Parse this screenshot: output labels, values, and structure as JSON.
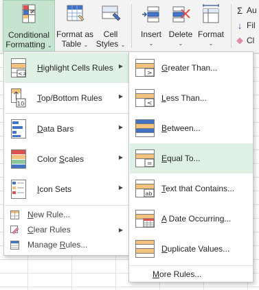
{
  "colors": {
    "accent_green": "#c5e3cf",
    "hover_green": "#dff0e4",
    "icon_orange": "#f2c27e",
    "icon_blue": "#4472c4",
    "icon_red": "#d9534f"
  },
  "ribbon": {
    "conditional_formatting": {
      "line1": "Conditional",
      "line2": "Formatting",
      "chevron": "⌄",
      "icon": "conditional-formatting-icon"
    },
    "format_as_table": {
      "line1": "Format as",
      "line2": "Table",
      "chevron": "⌄",
      "icon": "table-icon"
    },
    "cell_styles": {
      "line1": "Cell",
      "line2": "Styles",
      "chevron": "⌄",
      "icon": "cell-styles-icon"
    },
    "insert": {
      "line1": "Insert",
      "chevron": "⌄",
      "icon": "insert-icon"
    },
    "delete": {
      "line1": "Delete",
      "chevron": "⌄",
      "icon": "delete-icon"
    },
    "format": {
      "line1": "Format",
      "chevron": "⌄",
      "icon": "format-icon"
    },
    "side": [
      {
        "icon_glyph": "Σ",
        "label": "Au",
        "icon": "autosum-icon"
      },
      {
        "icon_glyph": "↓",
        "label": "Fil",
        "icon": "fill-icon"
      },
      {
        "icon_glyph": "◆",
        "label": "Cl",
        "icon": "clear-icon"
      }
    ]
  },
  "menu": {
    "items": [
      {
        "label_u": "H",
        "label_rest": "ighlight Cells Rules",
        "arrow": "▶"
      },
      {
        "label_u": "T",
        "label_rest": "op/Bottom Rules",
        "arrow": "▶"
      },
      {
        "label_u": "D",
        "label_rest": "ata Bars",
        "arrow": "▶"
      },
      {
        "label_pre": "Color ",
        "label_u": "S",
        "label_rest": "cales",
        "arrow": "▶"
      },
      {
        "label_u": "I",
        "label_rest": "con Sets",
        "arrow": "▶"
      }
    ],
    "small": [
      {
        "label_u": "N",
        "label_rest": "ew Rule..."
      },
      {
        "label_u": "C",
        "label_rest": "lear Rules",
        "arrow": "▶"
      },
      {
        "label_pre": "Manage ",
        "label_u": "R",
        "label_rest": "ules..."
      }
    ]
  },
  "submenu": {
    "items": [
      {
        "label_u": "G",
        "label_rest": "reater Than...",
        "glyph": ">"
      },
      {
        "label_u": "L",
        "label_rest": "ess Than...",
        "glyph": "<"
      },
      {
        "label_u": "B",
        "label_rest": "etween...",
        "glyph": ""
      },
      {
        "label_u": "E",
        "label_rest": "qual To...",
        "glyph": "="
      },
      {
        "label_u": "T",
        "label_rest": "ext that Contains...",
        "glyph": "ab"
      },
      {
        "label_u": "A",
        "label_rest": " Date Occurring...",
        "glyph": ""
      },
      {
        "label_u": "D",
        "label_rest": "uplicate Values...",
        "glyph": ""
      }
    ],
    "more": {
      "label_u": "M",
      "label_rest": "ore Rules..."
    }
  }
}
